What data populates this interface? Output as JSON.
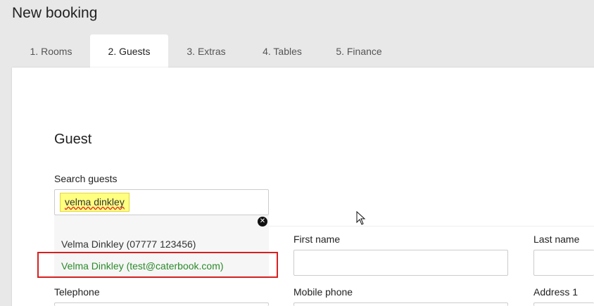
{
  "page": {
    "title": "New booking"
  },
  "tabs": [
    {
      "label": "1. Rooms"
    },
    {
      "label": "2. Guests"
    },
    {
      "label": "3. Extras"
    },
    {
      "label": "4. Tables"
    },
    {
      "label": "5. Finance"
    }
  ],
  "active_tab": "2. Guests",
  "guest": {
    "section_title": "Guest",
    "search_label": "Search guests",
    "search_value": "velma dinkley",
    "clear_icon": "close-icon",
    "results": [
      "Velma Dinkley (07777 123456)",
      "Velma Dinkley (test@caterbook.com)"
    ],
    "fields": {
      "first_name": "First name",
      "last_name": "Last name",
      "telephone": "Telephone",
      "mobile_phone": "Mobile phone",
      "address_1": "Address 1"
    }
  },
  "colors": {
    "selected_result": "#2a8a2a",
    "highlight_border": "#d62020",
    "search_highlight": "#ffff80"
  }
}
